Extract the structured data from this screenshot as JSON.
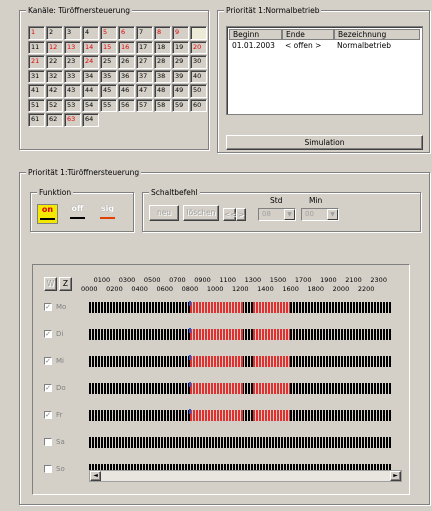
{
  "kanaele": {
    "legend": "Kanäle: Türöffnersteuerung",
    "cells": [
      {
        "n": "1",
        "red": true
      },
      {
        "n": "2",
        "red": false
      },
      {
        "n": "3",
        "red": false
      },
      {
        "n": "4",
        "red": false
      },
      {
        "n": "5",
        "red": true
      },
      {
        "n": "6",
        "red": true
      },
      {
        "n": "7",
        "red": false
      },
      {
        "n": "8",
        "red": true
      },
      {
        "n": "9",
        "red": true
      },
      {
        "n": "",
        "red": false,
        "sel": true
      },
      {
        "n": "11",
        "red": false
      },
      {
        "n": "12",
        "red": true
      },
      {
        "n": "13",
        "red": true
      },
      {
        "n": "14",
        "red": true
      },
      {
        "n": "15",
        "red": true
      },
      {
        "n": "16",
        "red": true
      },
      {
        "n": "17",
        "red": false
      },
      {
        "n": "18",
        "red": false
      },
      {
        "n": "19",
        "red": false
      },
      {
        "n": "20",
        "red": true
      },
      {
        "n": "21",
        "red": true
      },
      {
        "n": "22",
        "red": false
      },
      {
        "n": "23",
        "red": false
      },
      {
        "n": "24",
        "red": true
      },
      {
        "n": "25",
        "red": false
      },
      {
        "n": "26",
        "red": false
      },
      {
        "n": "27",
        "red": false
      },
      {
        "n": "28",
        "red": false
      },
      {
        "n": "29",
        "red": false
      },
      {
        "n": "30",
        "red": false
      },
      {
        "n": "31",
        "red": false
      },
      {
        "n": "32",
        "red": false
      },
      {
        "n": "33",
        "red": false
      },
      {
        "n": "34",
        "red": false
      },
      {
        "n": "35",
        "red": false
      },
      {
        "n": "36",
        "red": false
      },
      {
        "n": "37",
        "red": false
      },
      {
        "n": "38",
        "red": false
      },
      {
        "n": "39",
        "red": false
      },
      {
        "n": "40",
        "red": false
      },
      {
        "n": "41",
        "red": false
      },
      {
        "n": "42",
        "red": false
      },
      {
        "n": "43",
        "red": false
      },
      {
        "n": "44",
        "red": false
      },
      {
        "n": "45",
        "red": false
      },
      {
        "n": "46",
        "red": false
      },
      {
        "n": "47",
        "red": false
      },
      {
        "n": "48",
        "red": false
      },
      {
        "n": "49",
        "red": false
      },
      {
        "n": "50",
        "red": false
      },
      {
        "n": "51",
        "red": false
      },
      {
        "n": "52",
        "red": false
      },
      {
        "n": "53",
        "red": false
      },
      {
        "n": "54",
        "red": false
      },
      {
        "n": "55",
        "red": false
      },
      {
        "n": "56",
        "red": false
      },
      {
        "n": "57",
        "red": false
      },
      {
        "n": "58",
        "red": false
      },
      {
        "n": "59",
        "red": false
      },
      {
        "n": "60",
        "red": false
      },
      {
        "n": "61",
        "red": false
      },
      {
        "n": "62",
        "red": false
      },
      {
        "n": "63",
        "red": true
      },
      {
        "n": "64",
        "red": false
      }
    ]
  },
  "prioritaet": {
    "legend": "Priorität 1:Normalbetrieb",
    "cols": [
      "Beginn",
      "Ende",
      "Bezeichnung"
    ],
    "row": [
      "01.01.2003",
      "< offen >",
      "Normalbetrieb"
    ],
    "simulation": "Simulation"
  },
  "steuerung": {
    "legend": "Priorität 1:Türöffnersteuerung"
  },
  "funktion": {
    "legend": "Funktion",
    "buttons": [
      "on",
      "off",
      "sig"
    ]
  },
  "schaltbefehl": {
    "legend": "Schaltbefehl",
    "neu": "neu",
    "loeschen": "löschen",
    "std_label": "Std",
    "min_label": "Min",
    "std_value": "08",
    "min_value": "00"
  },
  "wochen": {
    "w": "W",
    "z": "Z"
  },
  "times_top": [
    "0100",
    "0300",
    "0500",
    "0700",
    "0900",
    "1100",
    "1300",
    "1500",
    "1700",
    "1900",
    "2100",
    "2300"
  ],
  "times_bottom": [
    "0000",
    "0200",
    "0400",
    "0600",
    "0800",
    "1000",
    "1200",
    "1400",
    "1600",
    "1800",
    "2000",
    "2200"
  ],
  "days": [
    {
      "label": "Mo",
      "checked": true,
      "segments": [
        [
          "08:00",
          "12:15"
        ],
        [
          "13:00",
          "16:00"
        ]
      ],
      "mark": "08:00"
    },
    {
      "label": "Di",
      "checked": true,
      "segments": [
        [
          "08:00",
          "12:15"
        ],
        [
          "13:00",
          "16:00"
        ]
      ],
      "mark": "08:00"
    },
    {
      "label": "Mi",
      "checked": true,
      "segments": [
        [
          "08:00",
          "12:15"
        ],
        [
          "13:00",
          "16:00"
        ]
      ],
      "mark": "08:00"
    },
    {
      "label": "Do",
      "checked": true,
      "segments": [
        [
          "08:00",
          "12:15"
        ],
        [
          "13:00",
          "16:00"
        ]
      ],
      "mark": "08:00"
    },
    {
      "label": "Fr",
      "checked": true,
      "segments": [
        [
          "08:00",
          "12:15"
        ],
        [
          "13:00",
          "16:00"
        ]
      ],
      "mark": "08:00"
    },
    {
      "label": "Sa",
      "checked": false,
      "segments": [],
      "mark": null
    },
    {
      "label": "So",
      "checked": false,
      "segments": [],
      "mark": null
    }
  ],
  "scrollbar": {
    "left": "◄",
    "right": "►"
  }
}
